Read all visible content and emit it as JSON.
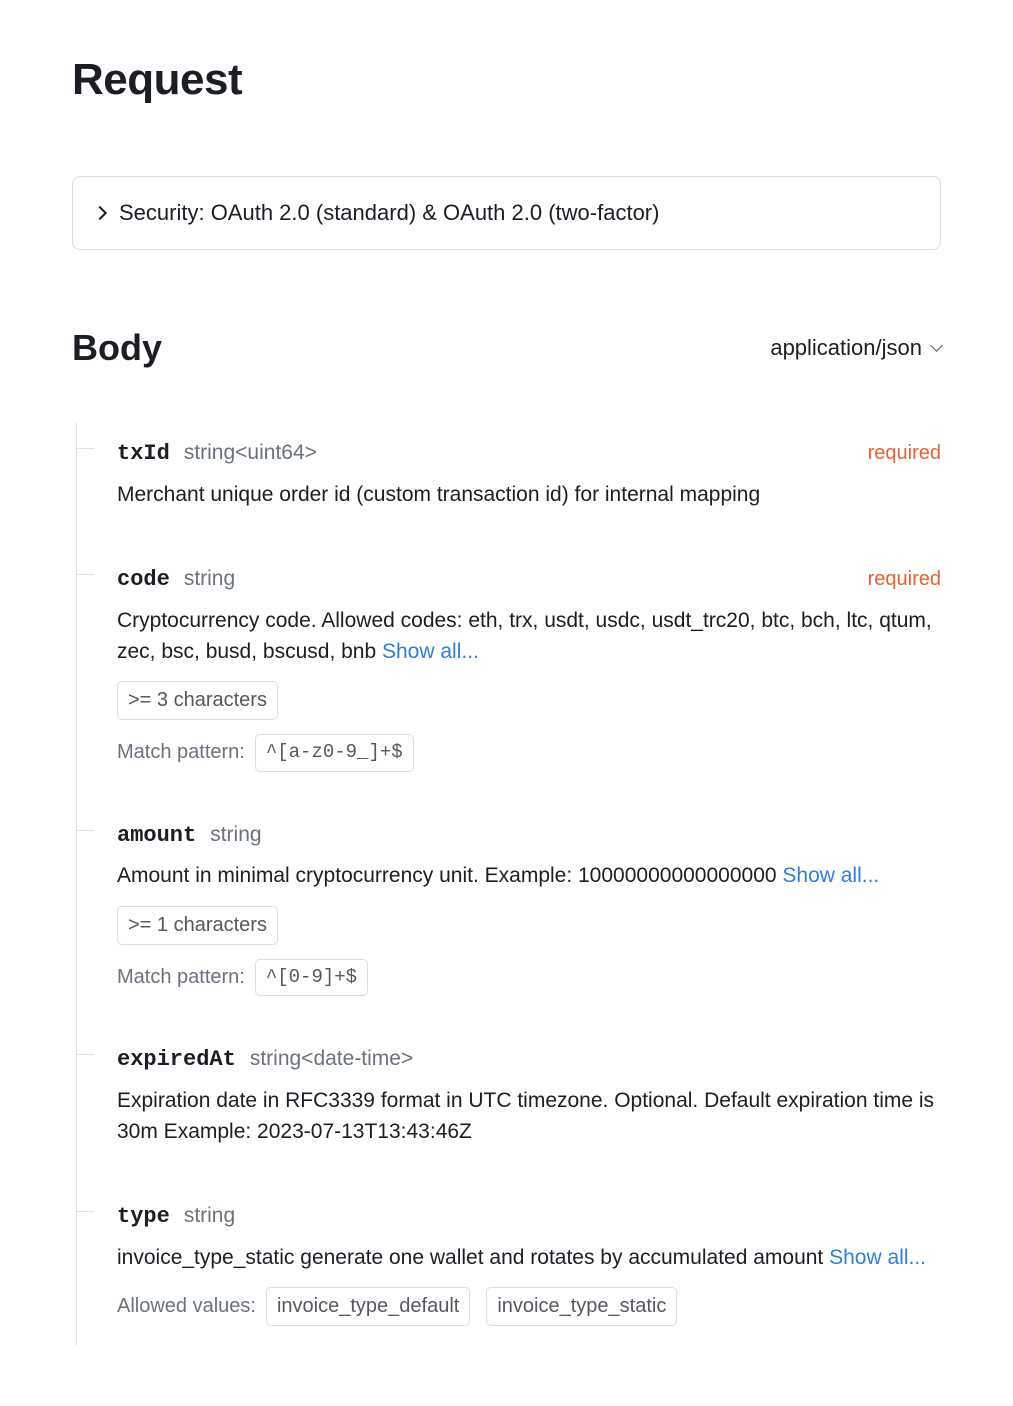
{
  "title": "Request",
  "security": {
    "label": "Security: OAuth 2.0 (standard) & OAuth 2.0 (two-factor)"
  },
  "body": {
    "title": "Body",
    "content_type": "application/json"
  },
  "labels": {
    "required": "required",
    "match_pattern": "Match pattern:",
    "allowed_values": "Allowed values:",
    "show_all": "Show all..."
  },
  "params": {
    "txId": {
      "name": "txId",
      "type": "string<uint64>",
      "required": true,
      "description": "Merchant unique order id (custom transaction id) for internal mapping"
    },
    "code": {
      "name": "code",
      "type": "string",
      "required": true,
      "description": "Cryptocurrency code. Allowed codes: eth, trx, usdt, usdc, usdt_trc20, btc, bch, ltc, qtum, zec, bsc, busd, bscusd, bnb ",
      "min_chars": ">= 3 characters",
      "pattern": "^[a-z0-9_]+$"
    },
    "amount": {
      "name": "amount",
      "type": "string",
      "description": "Amount in minimal cryptocurrency unit. Example: 10000000000000000 ",
      "min_chars": ">= 1 characters",
      "pattern": "^[0-9]+$"
    },
    "expiredAt": {
      "name": "expiredAt",
      "type": "string<date-time>",
      "description": "Expiration date in RFC3339 format in UTC timezone. Optional. Default expiration time is 30m Example: 2023-07-13T13:43:46Z"
    },
    "type": {
      "name": "type",
      "type": "string",
      "description": "invoice_type_static generate one wallet and rotates by accumulated amount ",
      "allowed": [
        "invoice_type_default",
        "invoice_type_static"
      ]
    }
  }
}
